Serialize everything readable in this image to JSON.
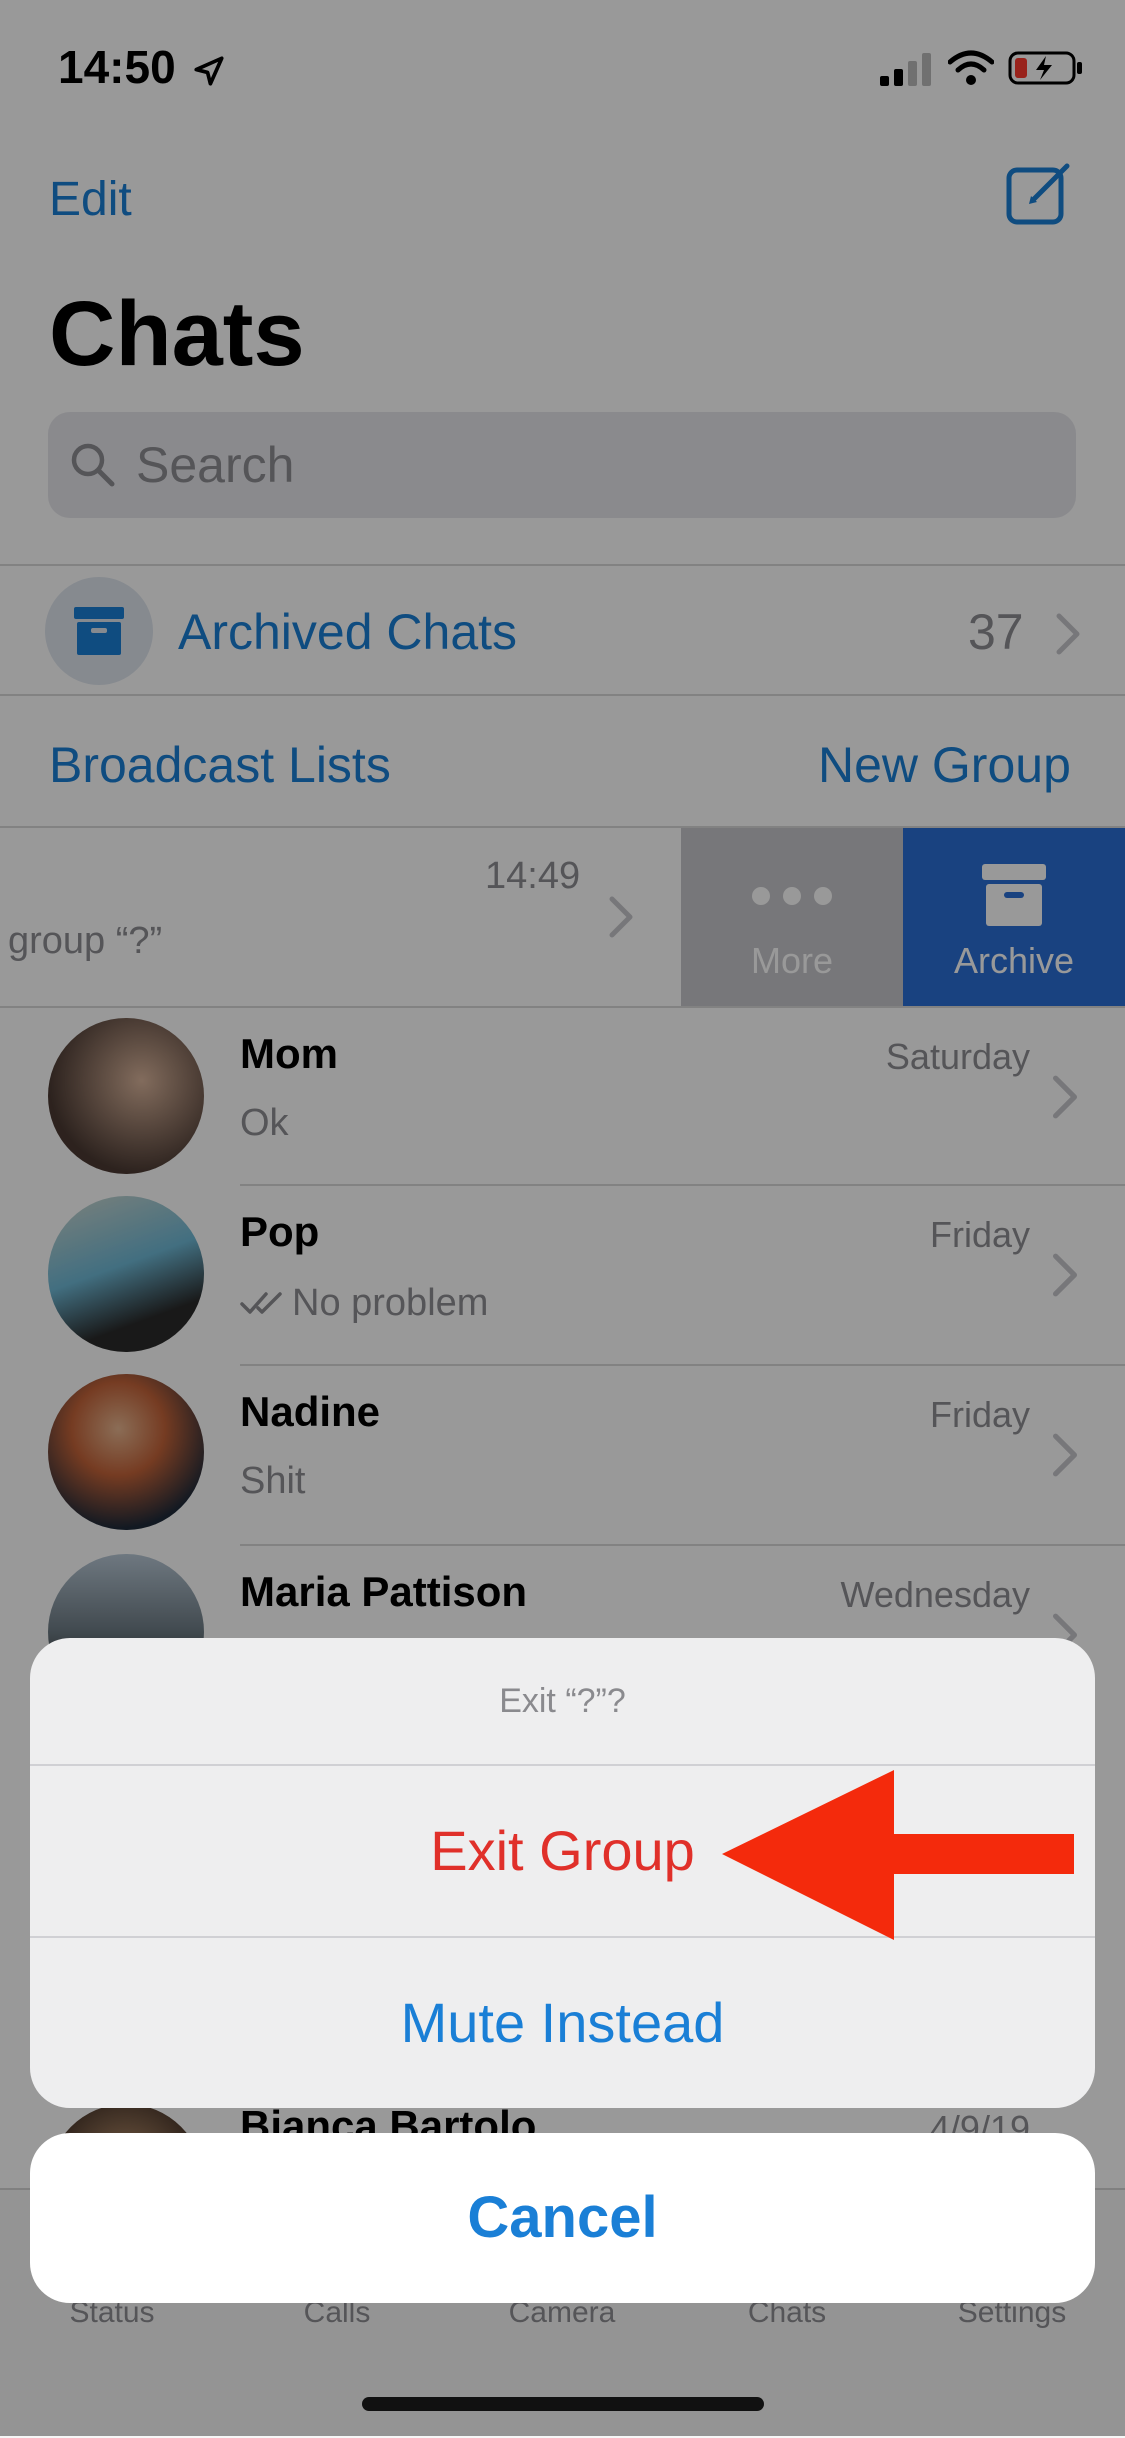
{
  "status_bar": {
    "time": "14:50"
  },
  "header": {
    "edit": "Edit",
    "title": "Chats",
    "search_placeholder": "Search"
  },
  "archived": {
    "label": "Archived Chats",
    "count": "37"
  },
  "links": {
    "broadcast": "Broadcast Lists",
    "new_group": "New Group"
  },
  "swiped_row": {
    "time": "14:49",
    "message": "group “?”",
    "more": "More",
    "archive": "Archive"
  },
  "chats": [
    {
      "name": "Mom",
      "message": "Ok",
      "date": "Saturday"
    },
    {
      "name": "Pop",
      "message": "No problem",
      "date": "Friday"
    },
    {
      "name": "Nadine",
      "message": "Shit",
      "date": "Friday"
    },
    {
      "name": "Maria Pattison",
      "message": "",
      "date": "Wednesday"
    },
    {
      "name": "Bianca Bartolo",
      "message": "",
      "date": "4/9/19"
    }
  ],
  "tabs": [
    "Status",
    "Calls",
    "Camera",
    "Chats",
    "Settings"
  ],
  "sheet": {
    "title": "Exit “?”?",
    "exit": "Exit Group",
    "mute": "Mute Instead",
    "cancel": "Cancel"
  },
  "colors": {
    "accent": "#1a7fd6",
    "destructive": "#e0302a",
    "arrow": "#f42a0c"
  }
}
